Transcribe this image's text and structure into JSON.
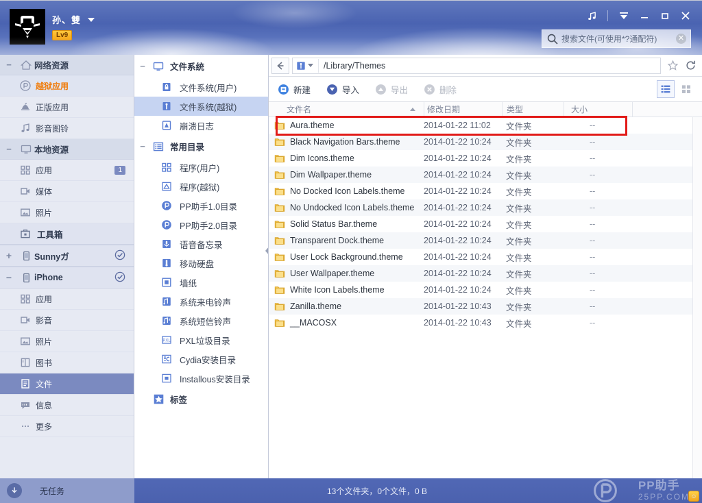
{
  "header": {
    "user_name": "孙、雙",
    "level_badge": "Lv9",
    "avatar_icon": "user-avatar-image",
    "dropdown_icon": "caret-down-icon",
    "window_controls": [
      {
        "name": "music-icon",
        "glyph": "♫"
      },
      {
        "name": "collapse-icon",
        "glyph": "⌄"
      },
      {
        "name": "minimize-icon",
        "glyph": "—"
      },
      {
        "name": "maximize-icon",
        "glyph": "▢"
      },
      {
        "name": "close-icon",
        "glyph": "✕"
      }
    ]
  },
  "search": {
    "placeholder": "搜索文件(可使用*?通配符)",
    "value": "",
    "icon": "search-icon",
    "clear_icon": "clear-icon",
    "clear_glyph": "✕"
  },
  "sidebar": {
    "groups": [
      {
        "label": "网络资源",
        "toggle": "−",
        "icon": "home-icon",
        "items": [
          {
            "label": "越狱应用",
            "icon": "pp-icon",
            "state": "active-orange"
          },
          {
            "label": "正版应用",
            "icon": "apple-store-icon",
            "state": "normal"
          },
          {
            "label": "影音图铃",
            "icon": "music-note-icon",
            "state": "normal"
          }
        ]
      },
      {
        "label": "本地资源",
        "toggle": "−",
        "icon": "monitor-icon",
        "items": [
          {
            "label": "应用",
            "icon": "apps-grid-icon",
            "badge": "1",
            "state": "normal"
          },
          {
            "label": "媒体",
            "icon": "video-camera-icon",
            "state": "normal"
          },
          {
            "label": "照片",
            "icon": "photo-icon",
            "state": "normal"
          }
        ]
      }
    ],
    "toolbox": {
      "label": "工具箱",
      "icon": "toolbox-icon"
    },
    "devices": [
      {
        "label": "Sunnyガ",
        "toggle": "+",
        "icon": "phone-icon",
        "status_icon": "check-circle-icon",
        "items": []
      },
      {
        "label": "iPhone",
        "toggle": "−",
        "icon": "phone-icon",
        "status_icon": "check-circle-icon",
        "items": [
          {
            "label": "应用",
            "icon": "apps-grid-icon",
            "state": "normal"
          },
          {
            "label": "影音",
            "icon": "video-camera-icon",
            "state": "normal"
          },
          {
            "label": "照片",
            "icon": "photo-icon",
            "state": "normal"
          },
          {
            "label": "图书",
            "icon": "book-icon",
            "state": "normal"
          },
          {
            "label": "文件",
            "icon": "file-doc-icon",
            "state": "selected"
          },
          {
            "label": "信息",
            "icon": "message-icon",
            "state": "normal"
          },
          {
            "label": "更多",
            "icon": "more-dots-icon",
            "state": "normal"
          }
        ]
      }
    ]
  },
  "tree": {
    "collapse_handle_icon": "collapse-left-icon",
    "groups": [
      {
        "label": "文件系统",
        "toggle": "−",
        "icon": "monitor-icon",
        "items": [
          {
            "label": "文件系统(用户)",
            "icon": "lock-folder-icon",
            "state": "normal"
          },
          {
            "label": "文件系统(越狱)",
            "icon": "jailbreak-folder-icon",
            "state": "selected"
          },
          {
            "label": "崩溃日志",
            "icon": "warning-icon",
            "state": "normal"
          }
        ]
      },
      {
        "label": "常用目录",
        "toggle": "−",
        "icon": "list-icon",
        "items": [
          {
            "label": "程序(用户)",
            "icon": "apps-grid-icon",
            "state": "normal"
          },
          {
            "label": "程序(越狱)",
            "icon": "jailbreak-apps-icon",
            "state": "normal"
          },
          {
            "label": "PP助手1.0目录",
            "icon": "pp-icon",
            "state": "normal"
          },
          {
            "label": "PP助手2.0目录",
            "icon": "pp-icon",
            "state": "normal"
          },
          {
            "label": "语音备忘录",
            "icon": "microphone-icon",
            "state": "normal"
          },
          {
            "label": "移动硬盘",
            "icon": "usb-drive-icon",
            "state": "normal"
          },
          {
            "label": "墙纸",
            "icon": "wallpaper-icon",
            "state": "normal"
          },
          {
            "label": "系统来电铃声",
            "icon": "ringtone-icon",
            "state": "normal"
          },
          {
            "label": "系统短信铃声",
            "icon": "sms-tone-icon",
            "state": "normal"
          },
          {
            "label": "PXL垃圾目录",
            "icon": "pxl-icon",
            "state": "normal"
          },
          {
            "label": "Cydia安装目录",
            "icon": "cydia-icon",
            "state": "normal"
          },
          {
            "label": "Installous安装目录",
            "icon": "installous-icon",
            "state": "normal"
          }
        ]
      },
      {
        "label": "标签",
        "toggle": "",
        "icon": "star-icon",
        "items": []
      }
    ]
  },
  "main": {
    "pathbar": {
      "back_icon": "back-arrow-icon",
      "device_icon": "jailbreak-device-icon",
      "dropdown_icon": "caret-down-icon",
      "path": "/Library/Themes",
      "favorite_icon": "star-outline-icon",
      "refresh_icon": "refresh-icon"
    },
    "toolbar": {
      "buttons": [
        {
          "label": "新建",
          "icon": "new-folder-icon",
          "enabled": true
        },
        {
          "label": "导入",
          "icon": "import-icon",
          "enabled": true
        },
        {
          "label": "导出",
          "icon": "export-icon",
          "enabled": false
        },
        {
          "label": "删除",
          "icon": "delete-icon",
          "enabled": false
        }
      ],
      "views": [
        {
          "name": "list-view-icon",
          "active": true
        },
        {
          "name": "grid-view-icon",
          "active": false
        }
      ]
    },
    "columns": {
      "name": "文件名",
      "date": "修改日期",
      "type": "类型",
      "size": "大小",
      "sort_indicator": "sort-asc-icon"
    },
    "files": [
      {
        "name": "Aura.theme",
        "date": "2014-01-22 11:02",
        "type": "文件夹",
        "size": "--",
        "highlighted": true
      },
      {
        "name": "Black Navigation Bars.theme",
        "date": "2014-01-22 10:24",
        "type": "文件夹",
        "size": "--"
      },
      {
        "name": "Dim Icons.theme",
        "date": "2014-01-22 10:24",
        "type": "文件夹",
        "size": "--"
      },
      {
        "name": "Dim Wallpaper.theme",
        "date": "2014-01-22 10:24",
        "type": "文件夹",
        "size": "--"
      },
      {
        "name": "No Docked Icon Labels.theme",
        "date": "2014-01-22 10:24",
        "type": "文件夹",
        "size": "--"
      },
      {
        "name": "No Undocked Icon Labels.theme",
        "date": "2014-01-22 10:24",
        "type": "文件夹",
        "size": "--"
      },
      {
        "name": "Solid Status Bar.theme",
        "date": "2014-01-22 10:24",
        "type": "文件夹",
        "size": "--"
      },
      {
        "name": "Transparent Dock.theme",
        "date": "2014-01-22 10:24",
        "type": "文件夹",
        "size": "--"
      },
      {
        "name": "User Lock Background.theme",
        "date": "2014-01-22 10:24",
        "type": "文件夹",
        "size": "--"
      },
      {
        "name": "User Wallpaper.theme",
        "date": "2014-01-22 10:24",
        "type": "文件夹",
        "size": "--"
      },
      {
        "name": "White Icon Labels.theme",
        "date": "2014-01-22 10:24",
        "type": "文件夹",
        "size": "--"
      },
      {
        "name": "Zanilla.theme",
        "date": "2014-01-22 10:43",
        "type": "文件夹",
        "size": "--"
      },
      {
        "name": "__MACOSX",
        "date": "2014-01-22 10:43",
        "type": "文件夹",
        "size": "--"
      }
    ]
  },
  "statusbar": {
    "task_text": "无任务",
    "download_icon": "download-icon",
    "summary": "13个文件夹，0个文件，0 B",
    "watermark_title": "PP助手",
    "watermark_url": "25PP.COM",
    "watermark_logo": "pp-logo-icon",
    "tray_icon": "emoji-icon",
    "tray_glyph": "☺"
  },
  "colors": {
    "accent_blue": "#4a63b1",
    "selection_blue": "#7b8ac0",
    "tree_selection": "#c6d4f2",
    "orange_active": "#f07c0b",
    "highlight_red": "#e21b19",
    "badge_gold": "#f5a51a"
  }
}
